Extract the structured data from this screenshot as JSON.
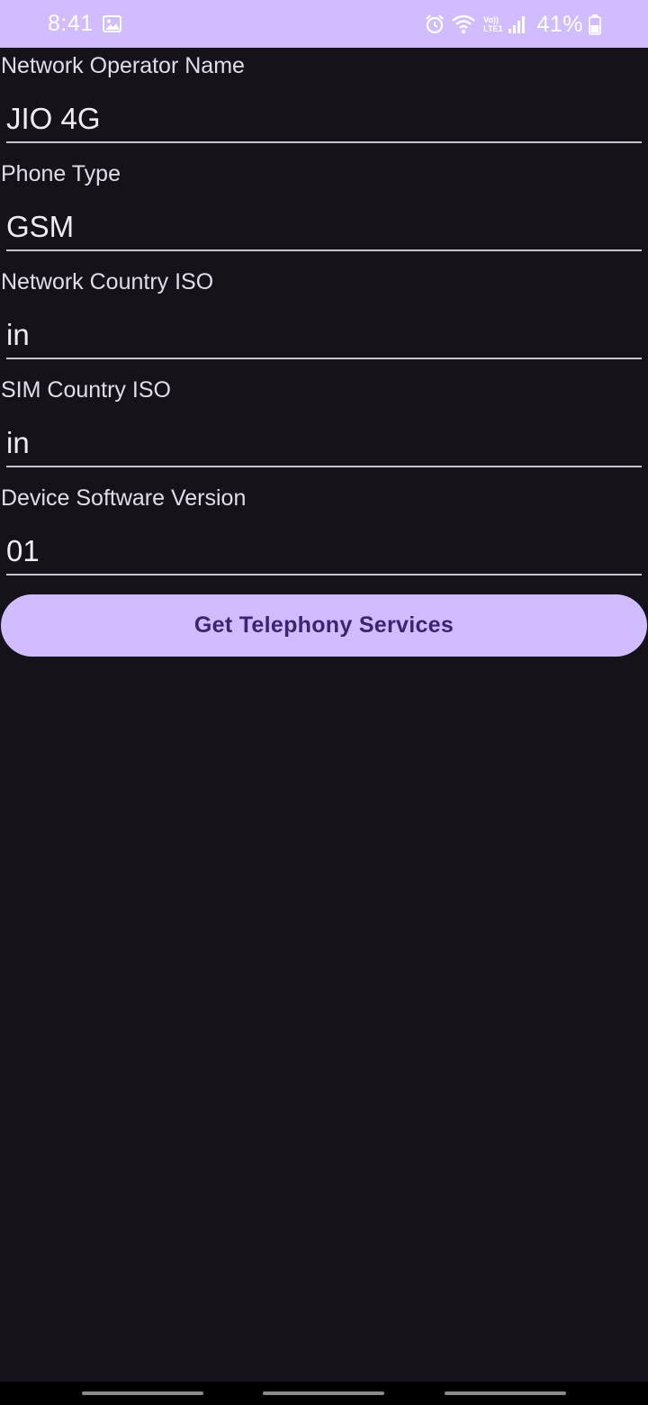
{
  "status_bar": {
    "time": "8:41",
    "battery": "41%",
    "volte_top": "Vo))",
    "volte_bottom": "LTE1",
    "icons": [
      "gallery-icon",
      "alarm-icon",
      "wifi-icon",
      "volte-icon",
      "signal-icon",
      "battery-icon"
    ]
  },
  "fields": [
    {
      "label": "Network Operator Name",
      "value": "JIO 4G"
    },
    {
      "label": "Phone Type",
      "value": "GSM"
    },
    {
      "label": "Network Country ISO",
      "value": "in"
    },
    {
      "label": "SIM Country ISO",
      "value": "in"
    },
    {
      "label": "Device Software Version",
      "value": "01"
    }
  ],
  "button": {
    "label": "Get Telephony Services"
  },
  "colors": {
    "accent": "#d0bcff",
    "background": "#15121a",
    "button_text": "#3b2572"
  }
}
